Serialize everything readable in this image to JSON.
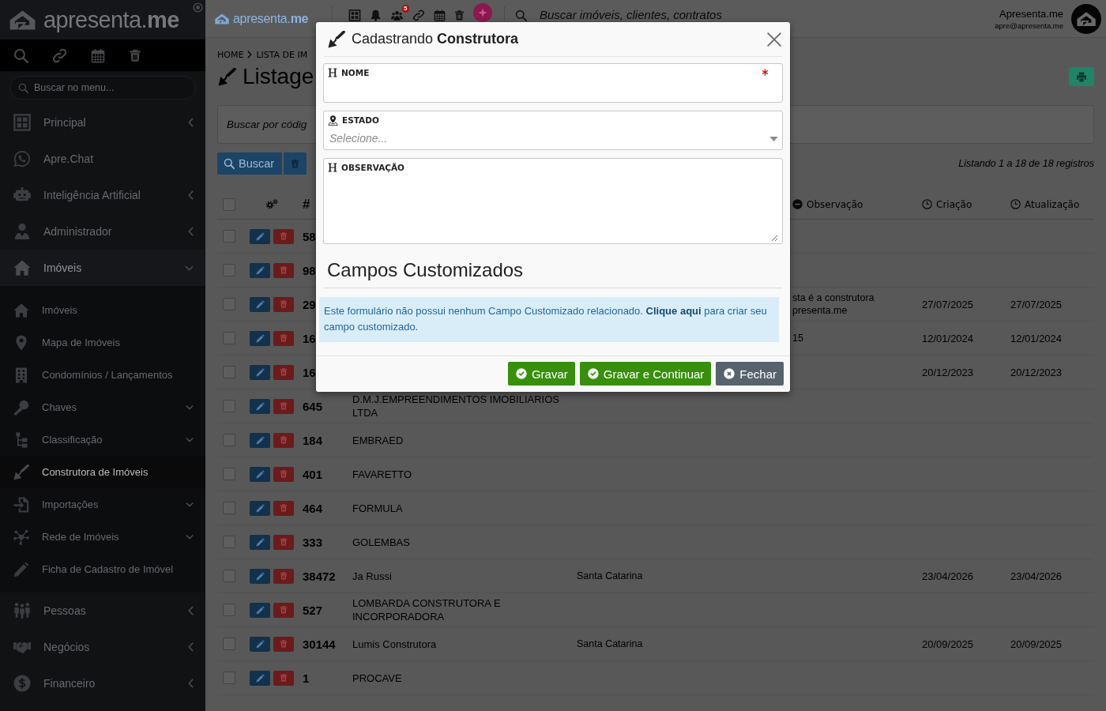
{
  "sidebar": {
    "logo": "apresenta.**me**",
    "search": {
      "placeholder": "Buscar no menu..."
    },
    "items": [
      {
        "label": "Principal",
        "expanded": false,
        "selected": false
      },
      {
        "label": "Apre.Chat",
        "selected": false
      },
      {
        "label": "Inteligência Artificial",
        "expanded": false,
        "selected": false
      },
      {
        "label": "Administrador",
        "expanded": false,
        "selected": false
      },
      {
        "label": "Imóveis",
        "expanded": true,
        "selected": false,
        "children": [
          {
            "label": "Imóveis",
            "selected": false
          },
          {
            "label": "Mapa de Imóveis",
            "selected": false
          },
          {
            "label": "Condomínios / Lançamentos",
            "selected": false
          },
          {
            "label": "Chaves",
            "expanded": false,
            "selected": false
          },
          {
            "label": "Classificação",
            "expanded": false,
            "selected": false
          },
          {
            "label": "Construtora de Imóveis",
            "selected": true
          },
          {
            "label": "Importações",
            "expanded": false,
            "selected": false
          },
          {
            "label": "Rede de Imóveis",
            "expanded": false,
            "selected": false
          },
          {
            "label": "Ficha de Cadastro de Imóvel",
            "selected": false
          }
        ]
      },
      {
        "label": "Pessoas",
        "expanded": false,
        "selected": false
      },
      {
        "label": "Negócios",
        "expanded": false,
        "selected": false
      },
      {
        "label": "Financeiro",
        "expanded": false,
        "selected": false
      }
    ]
  },
  "topbar": {
    "logo": "apresenta.**me**",
    "notification_count": "5",
    "search": {
      "placeholder": "Buscar imóveis, clientes, contratos"
    },
    "user": {
      "name": "Apresenta.me",
      "email": "apre@apresenta.me"
    }
  },
  "page": {
    "breadcrumb": [
      "HOME",
      "LISTA DE IM"
    ],
    "title": "Listage",
    "search": {
      "placeholder": "Buscar por códig"
    },
    "search_button": "Buscar",
    "listing_info": "Listando 1 a 18 de 18 registros"
  },
  "table": {
    "header": {
      "checked": false,
      "number": "#",
      "note": "Observação",
      "created": "Criação",
      "updated": "Atualização"
    },
    "rows": [
      {
        "checked": false,
        "number": "58"
      },
      {
        "checked": false,
        "number": "98"
      },
      {
        "checked": false,
        "number": "29",
        "note": "sta é a construtora presenta.me",
        "created": "27/07/2025",
        "updated": "27/07/2025"
      },
      {
        "checked": false,
        "number": "16",
        "note": "15",
        "created": "12/01/2024",
        "updated": "12/01/2024"
      },
      {
        "checked": false,
        "number": "16",
        "created": "20/12/2023",
        "updated": "20/12/2023"
      },
      {
        "checked": false,
        "number": "645",
        "column_4": "D.M.J.EMPREENDIMENTOS IMOBILIARIOS LTDA"
      },
      {
        "checked": false,
        "number": "184",
        "column_4": "EMBRAED"
      },
      {
        "checked": false,
        "number": "401",
        "column_4": "FAVARETTO"
      },
      {
        "checked": false,
        "number": "464",
        "column_4": "FORMULA"
      },
      {
        "checked": false,
        "number": "333",
        "column_4": "GOLEMBAS"
      },
      {
        "checked": false,
        "number": "38472",
        "column_4": "Ja Russi",
        "column_5": "Santa Catarina",
        "created": "23/04/2026",
        "updated": "23/04/2026"
      },
      {
        "checked": false,
        "number": "527",
        "column_4": "LOMBARDA CONSTRUTORA E INCORPORADORA"
      },
      {
        "checked": false,
        "number": "30144",
        "column_4": "Lumis Construtora",
        "column_5": "Santa Catarina",
        "created": "20/09/2025",
        "updated": "20/09/2025"
      },
      {
        "checked": false,
        "number": "1",
        "column_4": "PROCAVE"
      }
    ]
  },
  "modal": {
    "title": "Cadastrando **Construtora**",
    "fields": [
      {
        "kind": "text",
        "label": "NOME",
        "required": true
      },
      {
        "kind": "select",
        "label": "ESTADO",
        "placeholder": "Selecione..."
      },
      {
        "kind": "textarea",
        "label": "OBSERVAÇÃO"
      }
    ],
    "section_title": "Campos Customizados",
    "alert": {
      "text_before": "Este formulário não possui nenhum Campo Customizado relacionado.",
      "link": "Clique aqui",
      "text_after": "para criar seu campo customizado."
    },
    "buttons": [
      {
        "kind": "primary",
        "label": "Gravar"
      },
      {
        "kind": "primary",
        "label": "Gravar e Continuar"
      },
      {
        "kind": "secondary",
        "label": "Fechar"
      }
    ]
  }
}
